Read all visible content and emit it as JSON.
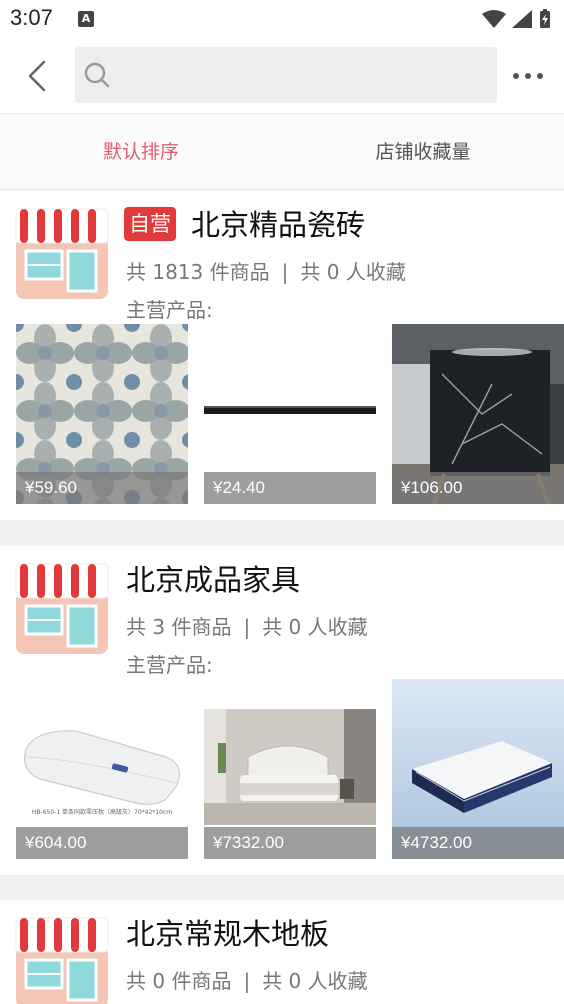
{
  "status_bar": {
    "time": "3:07",
    "notification_letter": "A"
  },
  "header": {
    "search_placeholder": "",
    "back_icon": "chevron-left-icon",
    "more_icon": "more-dots-icon"
  },
  "sort_tabs": [
    "默认排序",
    "店铺收藏量"
  ],
  "colors": {
    "accent": "#e35b6a",
    "badge": "#e23a3a"
  },
  "main_products_label": "主营产品:",
  "stores": [
    {
      "self_run_badge": "自营",
      "name": "北京精品瓷砖",
      "goods_count": "共 1813 件商品",
      "favorites": "共 0 人收藏",
      "products": [
        {
          "price": "¥59.60",
          "image": "floral-tile"
        },
        {
          "price": "¥24.40",
          "image": "black-trim-strip"
        },
        {
          "price": "¥106.00",
          "image": "black-marble-slab"
        }
      ]
    },
    {
      "name": "北京成品家具",
      "goods_count": "共 3 件商品",
      "favorites": "共 0 人收藏",
      "products": [
        {
          "price": "¥604.00",
          "image": "white-pillow",
          "caption": "HB-650-1  单条同款零压枕（高级灰）70*42*10cm"
        },
        {
          "price": "¥7332.00",
          "image": "bedroom-bed"
        },
        {
          "price": "¥4732.00",
          "image": "mattress"
        }
      ]
    },
    {
      "name": "北京常规木地板",
      "goods_count": "共 0 件商品",
      "favorites": "共 0 人收藏",
      "products": []
    }
  ]
}
